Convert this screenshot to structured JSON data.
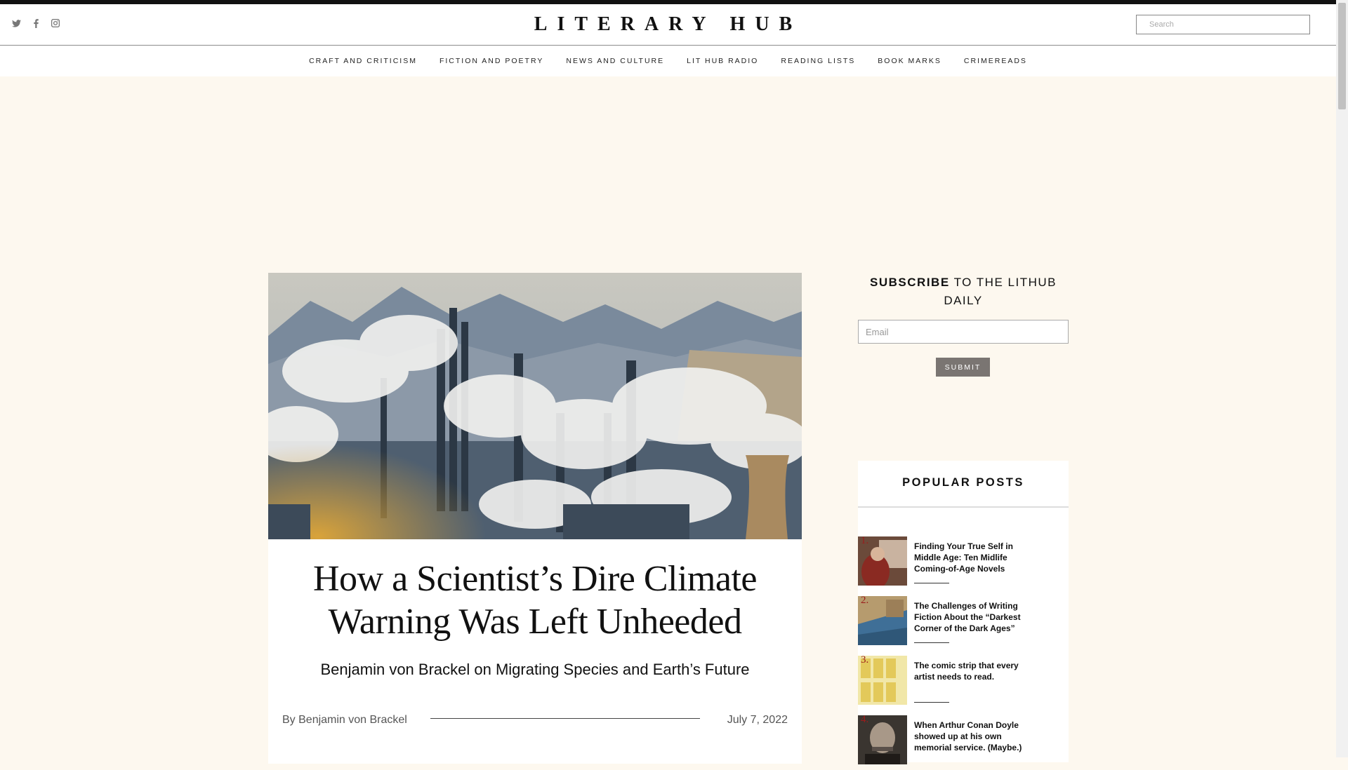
{
  "site": {
    "logo": "LITERARY HUB",
    "search_placeholder": "Search",
    "social": [
      "twitter-icon",
      "facebook-icon",
      "instagram-icon"
    ]
  },
  "nav": {
    "items": [
      {
        "label": "CRAFT AND CRITICISM"
      },
      {
        "label": "FICTION AND POETRY"
      },
      {
        "label": "NEWS AND CULTURE"
      },
      {
        "label": "LIT HUB RADIO"
      },
      {
        "label": "READING LISTS"
      },
      {
        "label": "BOOK MARKS"
      },
      {
        "label": "CRIMEREADS"
      }
    ]
  },
  "article": {
    "headline": "How a Scientist’s Dire Climate Warning Was Left Unheeded",
    "subhead": "Benjamin von Brackel on Migrating Species and Earth’s Future",
    "byline": "By Benjamin von Brackel",
    "date": "July 7, 2022",
    "hero_image": "industrial smokestacks and smog in mountain valley"
  },
  "subscribe": {
    "bold": "SUBSCRIBE",
    "rest": " TO THE LITHUB DAILY",
    "email_placeholder": "Email",
    "submit_label": "SUBMIT"
  },
  "popular": {
    "title": "POPULAR POSTS",
    "posts": [
      {
        "num": "1.",
        "title": "Finding Your True Self in Middle Age: Ten Midlife Coming-of-Age Novels"
      },
      {
        "num": "2.",
        "title": "The Challenges of Writing Fiction About the “Darkest Corner of the Dark Ages”"
      },
      {
        "num": "3.",
        "title": "The comic strip that every artist needs to read."
      },
      {
        "num": "4.",
        "title": "When Arthur Conan Doyle showed up at his own memorial service. (Maybe.)"
      }
    ]
  },
  "colors": {
    "page_bg": "#fdf8ef",
    "accent_number": "#9b1c1c",
    "submit_bg": "#7a7572"
  }
}
